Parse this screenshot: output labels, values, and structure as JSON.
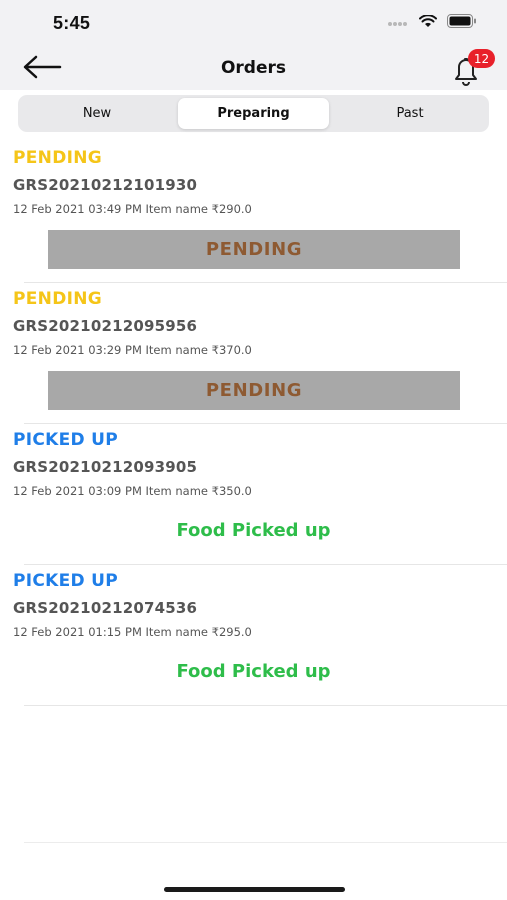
{
  "status_bar": {
    "time": "5:45"
  },
  "header": {
    "title": "Orders",
    "notification_count": "12"
  },
  "tabs": [
    {
      "label": "New",
      "active": false
    },
    {
      "label": "Preparing",
      "active": true
    },
    {
      "label": "Past",
      "active": false
    }
  ],
  "colors": {
    "pending": "#f5c518",
    "picked_up": "#1f7ee8",
    "picked_text": "#2ebd4a",
    "pending_button_bg": "#a8a8a8",
    "pending_button_text": "#8e5a32",
    "badge": "#e8202a"
  },
  "orders": [
    {
      "status": "PENDING",
      "id": "GRS20210212101930",
      "meta": "12 Feb 2021 03:49 PM Item name ₹290.0",
      "action": "PENDING"
    },
    {
      "status": "PENDING",
      "id": "GRS20210212095956",
      "meta": "12 Feb 2021 03:29 PM Item name ₹370.0",
      "action": "PENDING"
    },
    {
      "status": "PICKED UP",
      "id": "GRS20210212093905",
      "meta": "12 Feb 2021 03:09 PM Item name ₹350.0",
      "action": "Food Picked up"
    },
    {
      "status": "PICKED UP",
      "id": "GRS20210212074536",
      "meta": "12 Feb 2021 01:15 PM Item name ₹295.0",
      "action": "Food Picked up"
    }
  ]
}
